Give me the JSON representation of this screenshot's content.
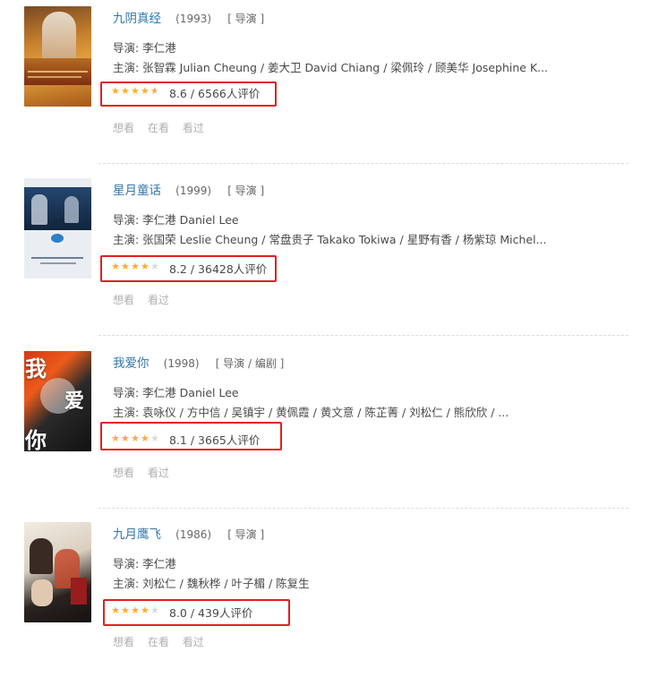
{
  "items": [
    {
      "title": "九阴真经",
      "year": "(1993)",
      "roles": "[ 导演 ]",
      "director": "导演: 李仁港",
      "cast": "主演: 张智霖 Julian Cheung / 姜大卫 David Chiang / 梁佩玲 / 顾美华 Josephine K...",
      "stars": 4.5,
      "rating": "8.6 / 6566人评价",
      "actions": [
        "想看",
        "在看",
        "看过"
      ]
    },
    {
      "title": "星月童话",
      "year": "(1999)",
      "roles": "[ 导演 ]",
      "director": "导演: 李仁港 Daniel Lee",
      "cast": "主演: 张国荣 Leslie Cheung / 常盘贵子 Takako Tokiwa / 星野有香 / 杨紫琼 Michel...",
      "stars": 4,
      "rating": "8.2 / 36428人评价",
      "actions": [
        "想看",
        "看过"
      ]
    },
    {
      "title": "我爱你",
      "year": "(1998)",
      "roles": "[ 导演 / 编剧 ]",
      "director": "导演: 李仁港 Daniel Lee",
      "cast": "主演: 袁咏仪 / 方中信 / 吴镇宇 / 黄佩霞 / 黄文意 / 陈芷菁 / 刘松仁 / 熊欣欣 / ...",
      "stars": 4,
      "rating": "8.1 / 3665人评价",
      "poster_text": [
        "我",
        "爱",
        "你"
      ],
      "actions": [
        "想看",
        "看过"
      ]
    },
    {
      "title": "九月鹰飞",
      "year": "(1986)",
      "roles": "[ 导演 ]",
      "director": "导演: 李仁港",
      "cast": "主演: 刘松仁 / 魏秋桦 / 叶子楣 / 陈复生",
      "stars": 4,
      "rating": "8.0 / 439人评价",
      "actions": [
        "想看",
        "在看",
        "看过"
      ]
    }
  ],
  "colors": {
    "title_link": "#3377aa",
    "star": "#ffac2d",
    "highlight_box": "#e02020",
    "action_text": "#b0b0b0"
  },
  "icons": {
    "star": "star-icon",
    "half_star": "half-star-icon"
  }
}
